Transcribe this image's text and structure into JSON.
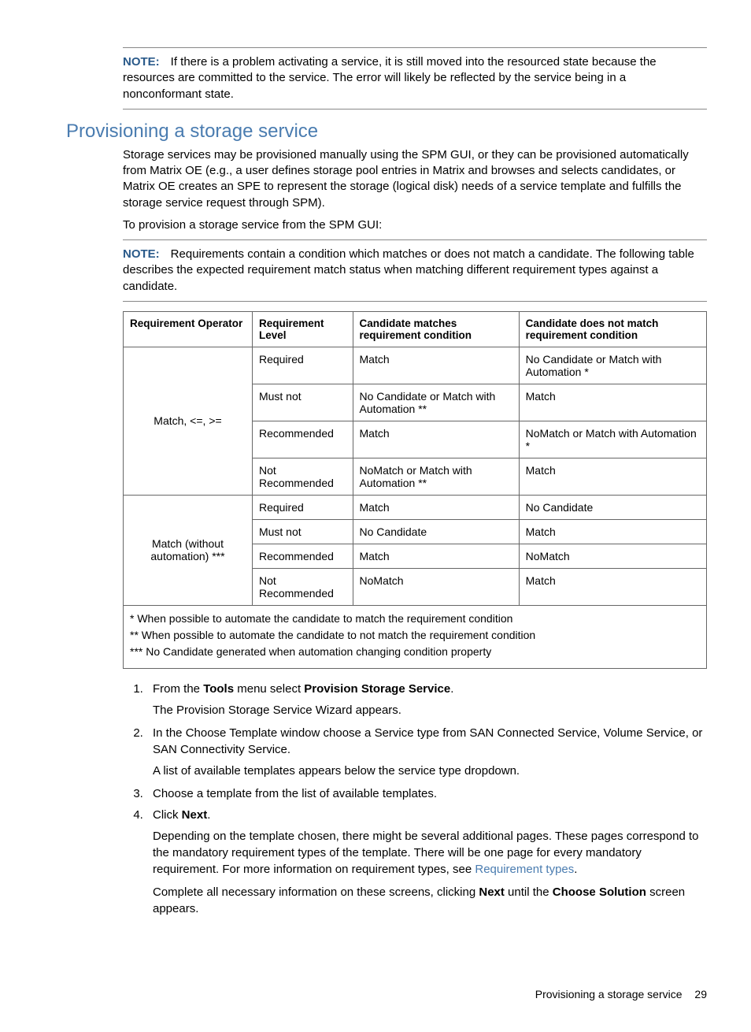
{
  "note1": {
    "label": "NOTE:",
    "text": "If there is a problem activating a service, it is still moved into the resourced state because the resources are committed to the service. The error will likely be reflected by the service being in a nonconformant state."
  },
  "heading": "Provisioning a storage service",
  "intro": "Storage services may be provisioned manually using the SPM GUI, or they can be provisioned automatically from Matrix OE (e.g., a user defines storage pool entries in Matrix and browses and selects candidates, or Matrix OE creates an SPE to represent the storage (logical disk) needs of a service template and fulfills the storage service request through SPM).",
  "intro2": "To provision a storage service from the SPM GUI:",
  "note2": {
    "label": "NOTE:",
    "text": "Requirements contain a condition which matches or does not match a candidate. The following table describes the expected requirement match status when matching different requirement types against a candidate."
  },
  "table": {
    "headers": [
      "Requirement Operator",
      "Requirement Level",
      "Candidate matches requirement condition",
      "Candidate does not match requirement condition"
    ],
    "groups": [
      {
        "operator": "Match, <=, >=",
        "rows": [
          [
            "Required",
            "Match",
            "No Candidate or Match with Automation *"
          ],
          [
            "Must not",
            "No Candidate or Match with Automation **",
            "Match"
          ],
          [
            "Recommended",
            "Match",
            "NoMatch or Match with Automation *"
          ],
          [
            "Not Recommended",
            "NoMatch or Match with Automation **",
            "Match"
          ]
        ]
      },
      {
        "operator": "Match (without automation) ***",
        "rows": [
          [
            "Required",
            "Match",
            "No Candidate"
          ],
          [
            "Must not",
            "No Candidate",
            "Match"
          ],
          [
            "Recommended",
            "Match",
            "NoMatch"
          ],
          [
            "Not Recommended",
            "NoMatch",
            "Match"
          ]
        ]
      }
    ]
  },
  "footnotes": [
    "* When possible to automate the candidate to match the requirement condition",
    "** When possible to automate the candidate to not match the requirement condition",
    "*** No Candidate generated when automation changing condition property"
  ],
  "steps": {
    "s1a": "From the ",
    "s1b": "Tools",
    "s1c": " menu select ",
    "s1d": "Provision Storage Service",
    "s1e": ".",
    "s1sub": "The Provision Storage Service Wizard appears.",
    "s2": "In the Choose Template window choose a Service type from SAN Connected Service, Volume Service, or SAN Connectivity Service.",
    "s2sub": "A list of available templates appears below the service type dropdown.",
    "s3": "Choose a template from the list of available templates.",
    "s4a": "Click ",
    "s4b": "Next",
    "s4c": ".",
    "s4sub1": "Depending on the template chosen, there might be several additional pages. These pages correspond to the mandatory requirement types of the template. There will be one page for every mandatory requirement. For more information on requirement types, see ",
    "s4link": "Requirement types",
    "s4sub1b": ".",
    "s4sub2a": "Complete all necessary information on these screens, clicking ",
    "s4sub2b": "Next",
    "s4sub2c": " until the ",
    "s4sub2d": "Choose Solution",
    "s4sub2e": " screen appears."
  },
  "footer": {
    "title": "Provisioning a storage service",
    "page": "29"
  }
}
